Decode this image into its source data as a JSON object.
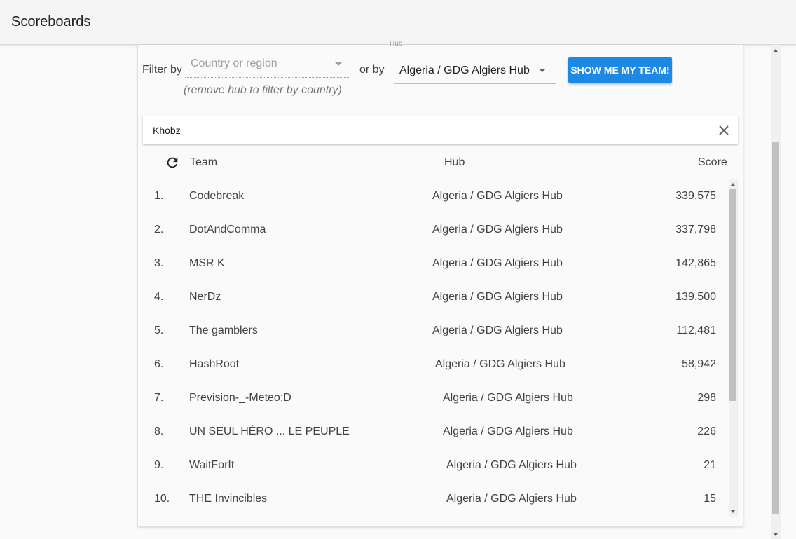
{
  "app": {
    "title": "Scoreboards"
  },
  "filters": {
    "filter_by_label": "Filter by",
    "country_placeholder": "Country or region",
    "country_hint": "(remove hub to filter by country)",
    "or_by_label": "or by",
    "hub_label": "Hub",
    "hub_value": "Algeria / GDG Algiers Hub",
    "show_team_button": "SHOW ME MY TEAM!"
  },
  "search": {
    "value": "Khobz"
  },
  "table": {
    "columns": {
      "team": "Team",
      "hub": "Hub",
      "score": "Score"
    },
    "rows": [
      {
        "rank": "1.",
        "team": "Codebreak",
        "hub": "Algeria / GDG Algiers Hub",
        "score": "339,575"
      },
      {
        "rank": "2.",
        "team": "DotAndComma",
        "hub": "Algeria / GDG Algiers Hub",
        "score": "337,798"
      },
      {
        "rank": "3.",
        "team": "MSR K",
        "hub": "Algeria / GDG Algiers Hub",
        "score": "142,865"
      },
      {
        "rank": "4.",
        "team": "NerDz",
        "hub": "Algeria / GDG Algiers Hub",
        "score": "139,500"
      },
      {
        "rank": "5.",
        "team": "The gamblers",
        "hub": "Algeria / GDG Algiers Hub",
        "score": "112,481"
      },
      {
        "rank": "6.",
        "team": "HashRoot",
        "hub": "Algeria / GDG Algiers Hub",
        "score": "58,942"
      },
      {
        "rank": "7.",
        "team": "Prevision-_-Meteo:D",
        "hub": "Algeria / GDG Algiers Hub",
        "score": "298"
      },
      {
        "rank": "8.",
        "team": "UN SEUL HÉRO ... LE PEUPLE",
        "hub": "Algeria / GDG Algiers Hub",
        "score": "226"
      },
      {
        "rank": "9.",
        "team": "WaitForIt",
        "hub": "Algeria / GDG Algiers Hub",
        "score": "21"
      },
      {
        "rank": "10.",
        "team": "THE Invincibles",
        "hub": "Algeria / GDG Algiers Hub",
        "score": "15"
      }
    ]
  },
  "icons": {
    "refresh": "refresh-icon",
    "clear": "close-icon",
    "dropdown": "chevron-down-icon"
  },
  "colors": {
    "accent": "#1e88e5",
    "topbar": "#f5f5f5"
  }
}
